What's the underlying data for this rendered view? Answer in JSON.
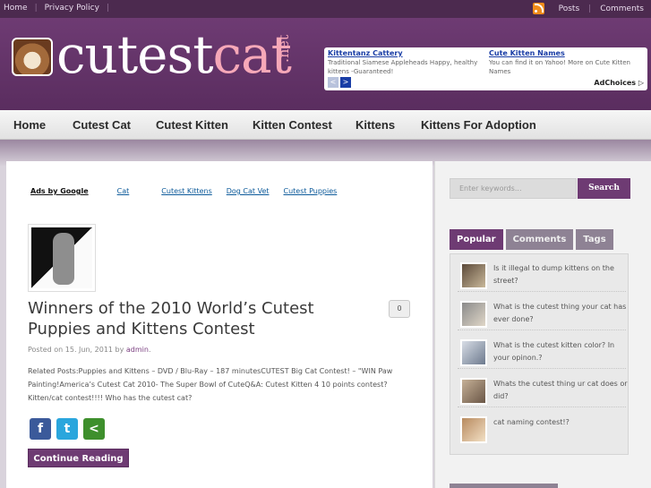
{
  "topbar": {
    "links": [
      "Home",
      "Privacy Policy"
    ],
    "right": [
      "Posts",
      "Comments"
    ]
  },
  "logo": {
    "part1": "cutest",
    "part2": "cat",
    "suffix": ".net"
  },
  "ads": {
    "items": [
      {
        "title": "Kittentanz Cattery",
        "desc": "Traditional Siamese Appleheads Happy, healthy kittens -Guaranteed!"
      },
      {
        "title": "Cute Kitten Names",
        "desc": "You can find it on Yahoo! More on Cute Kitten Names"
      }
    ],
    "prev": "<",
    "next": ">",
    "adchoices": "AdChoices ▷"
  },
  "nav": [
    "Home",
    "Cutest Cat",
    "Cutest Kitten",
    "Kitten Contest",
    "Kittens",
    "Kittens For Adoption"
  ],
  "adlinks": {
    "label": "Ads by Google",
    "links": [
      "Cat",
      "Cutest Kittens",
      "Dog Cat Vet",
      "Cutest Puppies"
    ]
  },
  "post": {
    "title": "Winners of the 2010 World’s Cutest Puppies and Kittens Contest",
    "comments": "0",
    "meta_prefix": "Posted on 15. Jun, 2011 by",
    "author": "admin",
    "meta_suffix": ".",
    "excerpt": "Related Posts:Puppies and Kittens – DVD / Blu-Ray – 187 minutesCUTEST Big Cat Contest! – \"WIN Paw Painting!America’s Cutest Cat 2010- The Super Bowl of CuteQ&A: Cutest Kitten 4 10 points contest?Kitten/cat contest!!!! Who has the cutest cat?",
    "continue": "Continue Reading"
  },
  "share": {
    "facebook": "f",
    "twitter": "t",
    "share": "<"
  },
  "sidebar": {
    "search_placeholder": "Enter keywords...",
    "search_button": "Search",
    "tabs": [
      "Popular",
      "Comments",
      "Tags"
    ],
    "popular": [
      "Is it illegal to dump kittens on the street?",
      "What is the cutest thing your cat has ever done?",
      "What is the cutest kitten color? In your opinon.?",
      "Whats the cutest thing ur cat does or did?",
      "cat naming contest!?"
    ]
  },
  "colors": {
    "brand": "#6e3b73",
    "accent": "#f6a8b8",
    "topbar": "#4c2a4f"
  }
}
